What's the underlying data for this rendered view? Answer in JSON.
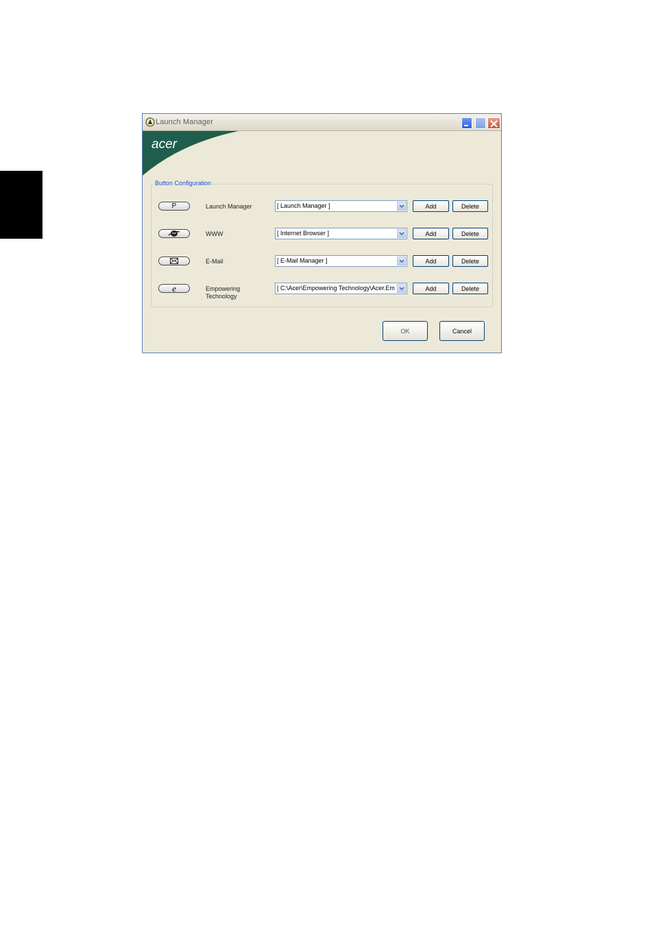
{
  "window": {
    "title": "Launch Manager",
    "brand": "acer",
    "colors": {
      "banner": "#1f5e4c",
      "title_text": "#5f5f5f",
      "group_label": "#1f4fd6",
      "close": "#c4553e"
    }
  },
  "group": {
    "label": "Button Configuration"
  },
  "rows": [
    {
      "key_glyph": "P",
      "key_icon": "p-key-icon",
      "label": "Launch Manager",
      "value": "[ Launch Manager ]",
      "add": "Add",
      "delete": "Delete"
    },
    {
      "key_glyph": "",
      "key_icon": "browser-globe-icon",
      "label": "WWW",
      "value": "[ Internet Browser ]",
      "add": "Add",
      "delete": "Delete"
    },
    {
      "key_glyph": "",
      "key_icon": "envelope-icon",
      "label": "E-Mail",
      "value": "[ E-Mail Manager ]",
      "add": "Add",
      "delete": "Delete"
    },
    {
      "key_glyph": "e",
      "key_icon": "empowering-e-icon",
      "label": "Empowering Technology",
      "value": "[ C:\\Acer\\Empowering Technology\\Acer.Em",
      "add": "Add",
      "delete": "Delete"
    }
  ],
  "footer": {
    "ok": "OK",
    "cancel": "Cancel"
  }
}
